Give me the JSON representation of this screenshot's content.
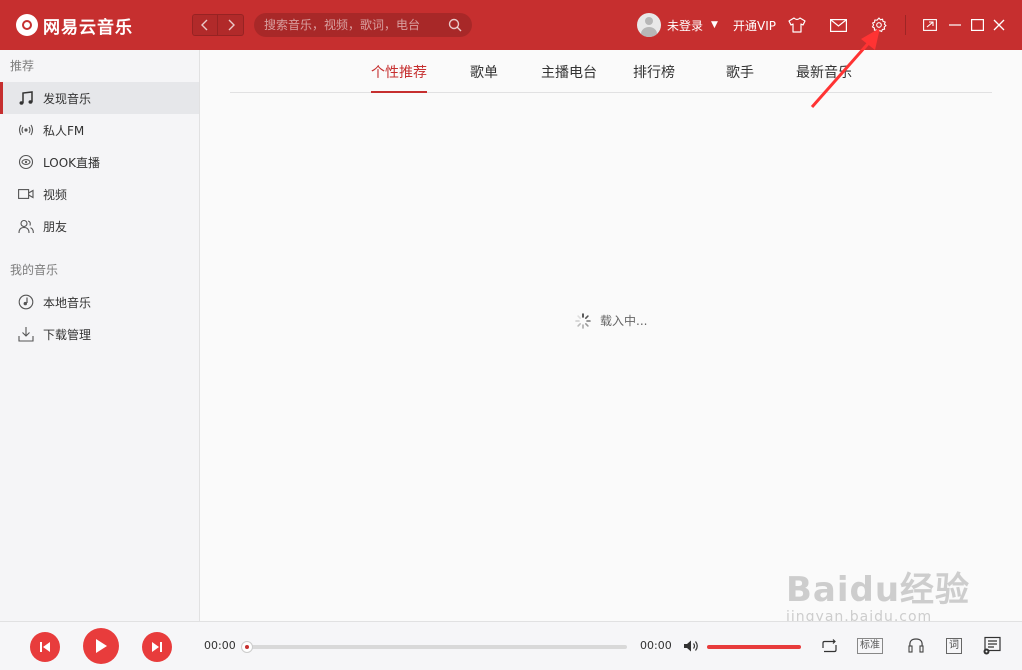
{
  "app": {
    "title": "网易云音乐",
    "accent_color": "#c62f2f"
  },
  "titlebar": {
    "back_icon": "chevron-left-icon",
    "forward_icon": "chevron-right-icon",
    "search_placeholder": "搜索音乐，视频，歌词，电台",
    "username": "未登录",
    "vip_label": "开通VIP"
  },
  "sidebar": {
    "sections": [
      {
        "title": "推荐",
        "items": [
          {
            "label": "发现音乐",
            "icon": "music-note-icon",
            "active": true
          },
          {
            "label": "私人FM",
            "icon": "radio-icon",
            "active": false
          },
          {
            "label": "LOOK直播",
            "icon": "live-icon",
            "active": false
          },
          {
            "label": "视频",
            "icon": "video-icon",
            "active": false
          },
          {
            "label": "朋友",
            "icon": "friends-icon",
            "active": false
          }
        ]
      },
      {
        "title": "我的音乐",
        "items": [
          {
            "label": "本地音乐",
            "icon": "local-music-icon",
            "active": false
          },
          {
            "label": "下载管理",
            "icon": "download-icon",
            "active": false
          }
        ]
      }
    ]
  },
  "main": {
    "tabs": [
      {
        "label": "个性推荐",
        "active": true
      },
      {
        "label": "歌单",
        "active": false
      },
      {
        "label": "主播电台",
        "active": false
      },
      {
        "label": "排行榜",
        "active": false
      },
      {
        "label": "歌手",
        "active": false
      },
      {
        "label": "最新音乐",
        "active": false
      }
    ],
    "loading_text": "载入中..."
  },
  "player": {
    "current_time": "00:00",
    "total_time": "00:00",
    "progress": 0,
    "volume": 1.0,
    "quality_label": "标准",
    "lyric_label": "词"
  },
  "watermark": {
    "brand": "Baidu经验",
    "url": "jingyan.baidu.com"
  }
}
